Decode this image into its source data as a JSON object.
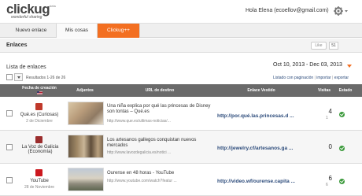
{
  "app": {
    "logo_text": "clickug",
    "logo_tagline": "wonderful sharing",
    "logo_beta": "beta",
    "greeting": "Hola Elena (ecoellov@gmail.com)"
  },
  "tabs": [
    {
      "label": "Nuevo enlace"
    },
    {
      "label": "Mis cosas"
    },
    {
      "label": "Clickug++"
    }
  ],
  "section": {
    "title": "Enlaces",
    "like_label": "Like",
    "like_count": "51"
  },
  "list": {
    "title": "Lista de enlaces",
    "date_range": "Oct 10, 2013 - Dec 03, 2013",
    "results": "Resultados 1-26 de 26",
    "links": {
      "paginated": "Listado con paginación",
      "import": "importar",
      "export": "exportar",
      "sep": "|"
    }
  },
  "table": {
    "headers": {
      "date": "Fecha de creación",
      "attachments": "Adjuntos",
      "dest_url": "URL de destino",
      "short_url": "Enlace Vestido",
      "visits": "Visitas",
      "status": "Estado"
    },
    "rows": [
      {
        "source": "Qué.es (Curiosas)",
        "date": "2 de Diciembre",
        "title": "Una niña explica por qué las princesas de Disney son tontas – Qué.es",
        "url": "http://www.que.es/ultimas-noticias/...",
        "short": "http://por.qué.las.princesas.d ...",
        "visits": "4",
        "visits_sub": "1",
        "icon_color": "#c0392b"
      },
      {
        "source": "La Voz de Galicia (Economía)",
        "date": "2 de Diciembre",
        "title": "Los artesanos gallegos conquistan nuevos mercados",
        "url": "http://www.lavozdegalicia.es/notici ...",
        "short": "http://jewelry.cf/artesanos.ga ...",
        "visits": "0",
        "visits_sub": "",
        "icon_color": "#9b2d2d"
      },
      {
        "source": "YouTube",
        "date": "28 de Noviembre",
        "title": "Ourense en 48 horas - YouTube",
        "url": "http://www.youtube.com/watch?featur ...",
        "short": "http://video.wf/ourense.capita ...",
        "visits": "6",
        "visits_sub": "6",
        "icon_color": "#cc181e"
      }
    ]
  },
  "colors": {
    "accent": "#f36f21",
    "header_bg": "#6a6a6a",
    "link": "#2b4a7a",
    "status_ok": "#3c9a3c"
  }
}
